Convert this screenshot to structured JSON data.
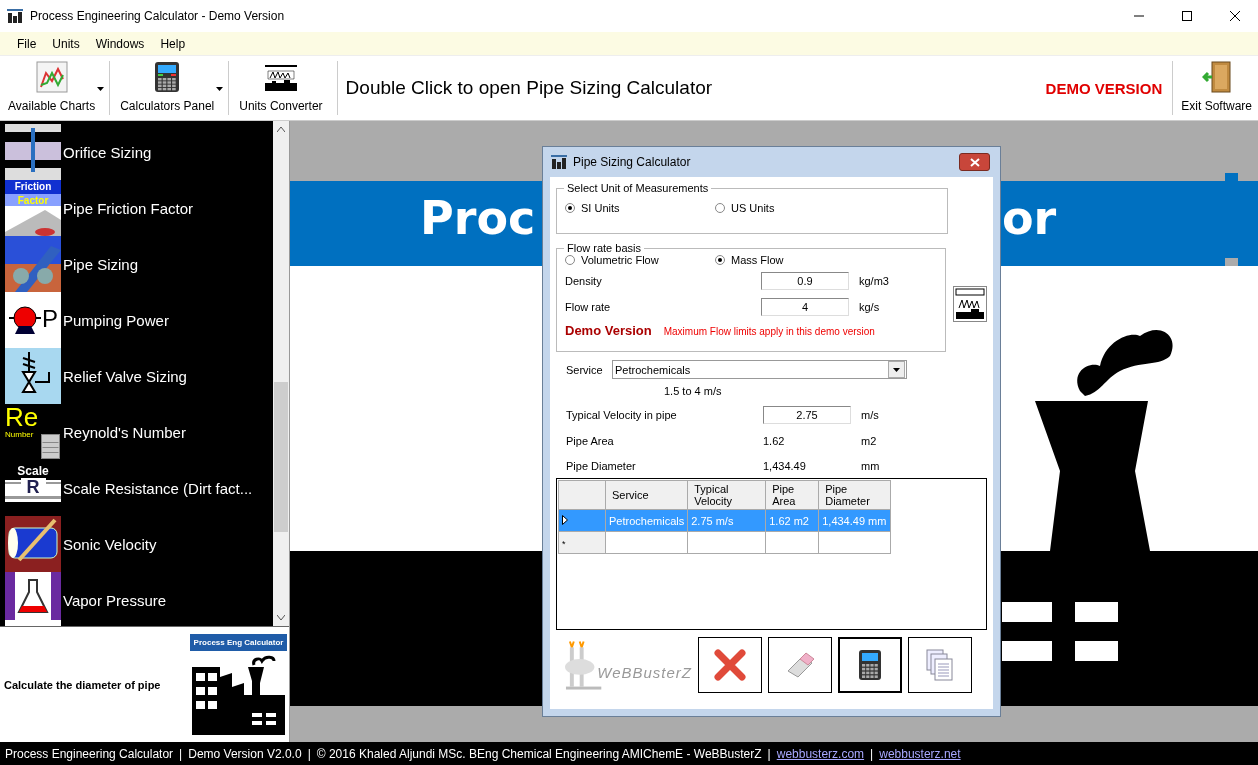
{
  "window": {
    "title": "Process Engineering Calculator - Demo Version"
  },
  "menu": [
    "File",
    "Units",
    "Windows",
    "Help"
  ],
  "toolbar": {
    "buttons": [
      {
        "kind": "charts",
        "label": "Available Charts",
        "dropdown": true
      },
      {
        "kind": "calculators",
        "label": "Calculators Panel",
        "dropdown": true
      },
      {
        "kind": "units",
        "label": "Units Converter",
        "dropdown": false
      }
    ],
    "hint": "Double Click to open Pipe Sizing Calculator",
    "demo": "DEMO VERSION",
    "exit": "Exit Software"
  },
  "sidebar": {
    "items": [
      {
        "label": "Orifice Sizing",
        "selected": false
      },
      {
        "label": "Pipe Friction Factor",
        "selected": false,
        "icon_text": [
          "Friction",
          "Factor"
        ]
      },
      {
        "label": "Pipe Sizing",
        "selected": false
      },
      {
        "label": "Pumping Power",
        "selected": false,
        "icon_text": [
          "P"
        ]
      },
      {
        "label": "Relief Valve Sizing",
        "selected": false
      },
      {
        "label": "Reynold's Number",
        "selected": false,
        "icon_text": [
          "Re",
          "Number"
        ]
      },
      {
        "label": "Scale Resistance (Dirt fact...",
        "selected": false,
        "icon_text": [
          "Scale",
          "R"
        ]
      },
      {
        "label": "Sonic Velocity",
        "selected": false
      },
      {
        "label": "Vapor Pressure",
        "selected": false
      }
    ],
    "description": "Calculate the diameter of pipe",
    "logo_title": "Process Eng Calculator"
  },
  "background": {
    "banner_left": "Proc",
    "banner_right": "or"
  },
  "dialog": {
    "title": "Pipe Sizing Calculator",
    "units": {
      "legend": "Select Unit of Measurements",
      "options": [
        {
          "label": "SI Units",
          "selected": true
        },
        {
          "label": "US Units",
          "selected": false
        }
      ]
    },
    "flow": {
      "legend": "Flow rate basis",
      "options": [
        {
          "label": "Volumetric Flow",
          "selected": false
        },
        {
          "label": "Mass Flow",
          "selected": true
        }
      ],
      "fields": [
        {
          "label": "Density",
          "value": "0.9",
          "unit": "kg/m3"
        },
        {
          "label": "Flow rate",
          "value": "4",
          "unit": "kg/s"
        }
      ],
      "demo_title": "Demo Version",
      "demo_note": "Maximum Flow limits apply in this demo version"
    },
    "service": {
      "label": "Service",
      "value": "Petrochemicals",
      "range": "1.5 to 4 m/s"
    },
    "velocity": {
      "label": "Typical Velocity in pipe",
      "value": "2.75",
      "unit": "m/s"
    },
    "results": [
      {
        "label": "Pipe Area",
        "value": "1.62",
        "unit": "m2"
      },
      {
        "label": "Pipe Diameter",
        "value": "1,434.49",
        "unit": "mm"
      }
    ],
    "table": {
      "columns": [
        "Service",
        "Typical Velocity",
        "Pipe Area",
        "Pipe Diameter"
      ],
      "rows": [
        {
          "selected": true,
          "cells": [
            "Petrochemicals",
            "2.75 m/s",
            "1.62 m2",
            "1,434.49 mm"
          ]
        }
      ],
      "new_row_marker": "*"
    },
    "logo_text": "WeBBusterZ",
    "buttons": [
      {
        "kind": "close",
        "focused": false
      },
      {
        "kind": "clear",
        "focused": false
      },
      {
        "kind": "calculate",
        "focused": true
      },
      {
        "kind": "copy",
        "focused": false
      }
    ]
  },
  "status_bar": [
    {
      "kind": "text",
      "text": "Process Engineering Calculator"
    },
    {
      "kind": "separator",
      "text": "|"
    },
    {
      "kind": "text",
      "text": "Demo Version V2.0.0"
    },
    {
      "kind": "separator",
      "text": "|"
    },
    {
      "kind": "text",
      "text": "© 2016 Khaled Aljundi MSc. BEng Chemical Engineering AMIChemE - WeBBusterZ"
    },
    {
      "kind": "separator",
      "text": "|"
    },
    {
      "kind": "link",
      "text": "webbusterz.com"
    },
    {
      "kind": "separator",
      "text": "|"
    },
    {
      "kind": "link",
      "text": "webbusterz.net"
    }
  ]
}
